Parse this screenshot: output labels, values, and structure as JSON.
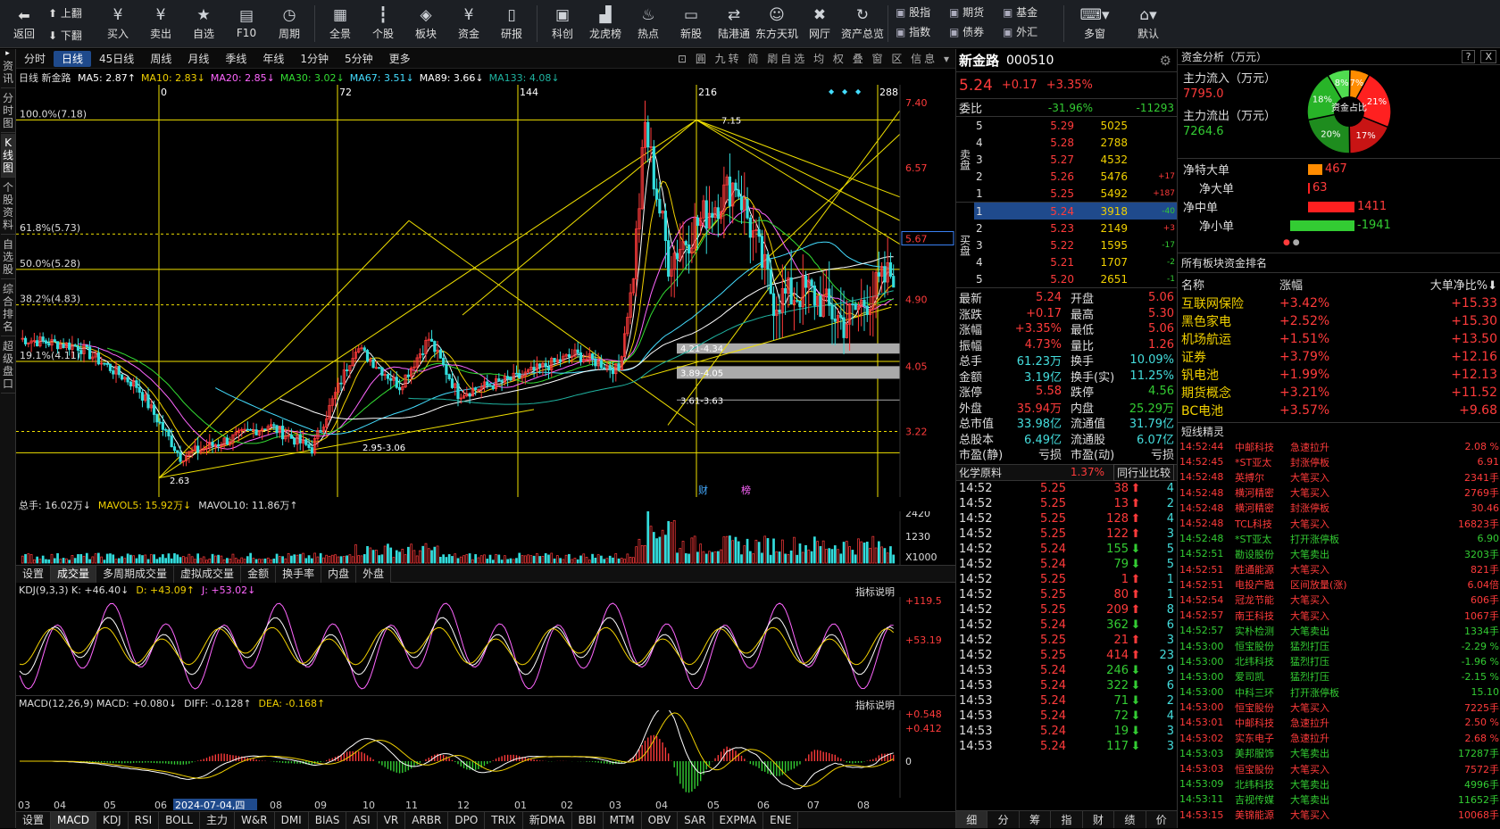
{
  "toolbar": {
    "nav": {
      "back": "返回",
      "up": "上翻",
      "down": "下翻"
    },
    "buttons": [
      {
        "label": "买入",
        "icon": "buy-icon",
        "glyph": "¥"
      },
      {
        "label": "卖出",
        "icon": "sell-icon",
        "glyph": "¥"
      },
      {
        "label": "自选",
        "icon": "star-icon",
        "glyph": "★"
      },
      {
        "label": "F10",
        "icon": "f10-icon",
        "glyph": "▤"
      },
      {
        "label": "周期",
        "icon": "clock-icon",
        "glyph": "◷"
      },
      {
        "label": "全景",
        "icon": "grid-icon",
        "glyph": "▦"
      },
      {
        "label": "个股",
        "icon": "candle-icon",
        "glyph": "┇"
      },
      {
        "label": "板块",
        "icon": "layers-icon",
        "glyph": "◈"
      },
      {
        "label": "资金",
        "icon": "money-icon",
        "glyph": "¥"
      },
      {
        "label": "研报",
        "icon": "report-icon",
        "glyph": "▯"
      },
      {
        "label": "科创",
        "icon": "tech-icon",
        "glyph": "▣"
      },
      {
        "label": "龙虎榜",
        "icon": "barchart-icon",
        "glyph": "▟"
      },
      {
        "label": "热点",
        "icon": "flame-icon",
        "glyph": "♨"
      },
      {
        "label": "新股",
        "icon": "ipo-icon",
        "glyph": "▭"
      },
      {
        "label": "陆港通",
        "icon": "link-icon",
        "glyph": "⇄"
      },
      {
        "label": "东方天玑",
        "icon": "robot-icon",
        "glyph": "☺"
      },
      {
        "label": "网厅",
        "icon": "close-x-icon",
        "glyph": "✖"
      },
      {
        "label": "资产总览",
        "icon": "refresh-icon",
        "glyph": "↻"
      }
    ],
    "small": [
      "股指",
      "期货",
      "基金",
      "指数",
      "债券",
      "外汇"
    ],
    "right": [
      {
        "label": "多窗",
        "icon": "multiwindow-icon",
        "glyph": "⌨"
      },
      {
        "label": "默认",
        "icon": "home-icon",
        "glyph": "⌂"
      }
    ]
  },
  "vtabs": [
    "资讯",
    "分时图",
    "K线图",
    "个股资料",
    "自选股",
    "综合排名",
    "超级盘口"
  ],
  "periods": [
    "分时",
    "日线",
    "45日线",
    "周线",
    "月线",
    "季线",
    "年线",
    "1分钟",
    "5分钟",
    "更多"
  ],
  "period_active": "日线",
  "period_right": "⊡ 圓 九转 简 㓾自选 均 权 叠 窗 区 信息 ▾",
  "ma_legend": {
    "label": "日线 新金路",
    "items": [
      {
        "t": "MA5: 2.87↑",
        "c": "#ffffff"
      },
      {
        "t": "MA10: 2.83↓",
        "c": "#f0d000"
      },
      {
        "t": "MA20: 2.85↓",
        "c": "#ff66ff"
      },
      {
        "t": "MA30: 3.02↓",
        "c": "#33dd33"
      },
      {
        "t": "MA67: 3.51↓",
        "c": "#44ddff"
      },
      {
        "t": "MA89: 3.66↓",
        "c": "#ffffff"
      },
      {
        "t": "MA133: 4.08↓",
        "c": "#1fb3a0"
      }
    ]
  },
  "kline": {
    "price_ticks": [
      "7.40",
      "6.57",
      "5.67",
      "4.90",
      "4.05",
      "3.22"
    ],
    "current_price_tag": "5.67",
    "fib": [
      {
        "t": "100.0%(7.18)"
      },
      {
        "t": "61.8%(5.73)"
      },
      {
        "t": "50.0%(5.28)"
      },
      {
        "t": "38.2%(4.83)"
      },
      {
        "t": "19.1%(4.11)"
      }
    ],
    "cycle_labels": [
      "0",
      "72",
      "144",
      "216",
      "288"
    ],
    "annotations": [
      "7.15",
      "2.63",
      "4.21-4.34",
      "3.89-4.05",
      "3.61-3.63",
      "2.95-3.06"
    ],
    "markers": [
      "财",
      "榜"
    ]
  },
  "volume": {
    "legend": [
      {
        "t": "总手: 16.02万↓",
        "c": "#ddd"
      },
      {
        "t": "MAVOL5: 15.92万↓",
        "c": "#f0d000"
      },
      {
        "t": "MAVOL10: 11.86万↑",
        "c": "#ddd"
      }
    ],
    "ticks": [
      "2420",
      "1230",
      "X1000"
    ]
  },
  "vol_tabs": [
    "设置",
    "成交量",
    "多周期成交量",
    "虚拟成交量",
    "金额",
    "换手率",
    "内盘",
    "外盘"
  ],
  "kdj": {
    "legend": [
      {
        "t": "KDJ(9,3,3) K: +46.40↓",
        "c": "#ddd"
      },
      {
        "t": "D: +43.09↑",
        "c": "#f0d000"
      },
      {
        "t": "J: +53.02↓",
        "c": "#ff66ff"
      }
    ],
    "ticks": [
      "+119.5",
      "+53.19"
    ],
    "explain": "指标说明"
  },
  "macd": {
    "legend": [
      {
        "t": "MACD(12,26,9) MACD: +0.080↓",
        "c": "#ddd"
      },
      {
        "t": "DIFF: -0.128↑",
        "c": "#ddd"
      },
      {
        "t": "DEA: -0.168↑",
        "c": "#f0d000"
      }
    ],
    "ticks": [
      "+0.548",
      "+0.412",
      "0"
    ],
    "explain": "指标说明"
  },
  "date_axis": [
    "03",
    "04",
    "05",
    "06",
    "2024-07-04,四",
    "08",
    "09",
    "10",
    "11",
    "12",
    "01",
    "02",
    "03",
    "04",
    "05",
    "06",
    "07",
    "08"
  ],
  "indicator_tabs": [
    "设置",
    "MACD",
    "KDJ",
    "RSI",
    "BOLL",
    "主力",
    "W&R",
    "DMI",
    "BIAS",
    "ASI",
    "VR",
    "ARBR",
    "DPO",
    "TRIX",
    "新DMA",
    "BBI",
    "MTM",
    "OBV",
    "SAR",
    "EXPMA",
    "ENE"
  ],
  "stock": {
    "name": "新金路",
    "code": "000510",
    "price": "5.24",
    "change": "+0.17",
    "pct": "+3.35%",
    "weibi_label": "委比",
    "weibi": "-31.96%",
    "weicha": "-11293",
    "sell_label": "卖盘",
    "buy_label": "买盘",
    "asks": [
      {
        "n": "5",
        "p": "5.29",
        "v": "5025",
        "d": ""
      },
      {
        "n": "4",
        "p": "5.28",
        "v": "2788",
        "d": ""
      },
      {
        "n": "3",
        "p": "5.27",
        "v": "4532",
        "d": ""
      },
      {
        "n": "2",
        "p": "5.26",
        "v": "5476",
        "d": "+17"
      },
      {
        "n": "1",
        "p": "5.25",
        "v": "5492",
        "d": "+187"
      }
    ],
    "bids": [
      {
        "n": "1",
        "p": "5.24",
        "v": "3918",
        "d": "-40"
      },
      {
        "n": "2",
        "p": "5.23",
        "v": "2149",
        "d": "+3"
      },
      {
        "n": "3",
        "p": "5.22",
        "v": "1595",
        "d": "-17"
      },
      {
        "n": "4",
        "p": "5.21",
        "v": "1707",
        "d": "-2"
      },
      {
        "n": "5",
        "p": "5.20",
        "v": "2651",
        "d": "-1"
      }
    ],
    "stats": [
      [
        "最新",
        "5.24",
        "red",
        "开盘",
        "5.06",
        "red"
      ],
      [
        "涨跌",
        "+0.17",
        "red",
        "最高",
        "5.30",
        "red"
      ],
      [
        "涨幅",
        "+3.35%",
        "red",
        "最低",
        "5.06",
        "red"
      ],
      [
        "振幅",
        "4.73%",
        "red",
        "量比",
        "1.26",
        "red"
      ],
      [
        "总手",
        "61.23万",
        "cyn",
        "换手",
        "10.09%",
        "cyn"
      ],
      [
        "金额",
        "3.19亿",
        "cyn",
        "换手(实)",
        "11.25%",
        "cyn"
      ],
      [
        "涨停",
        "5.58",
        "red",
        "跌停",
        "4.56",
        "grn"
      ],
      [
        "外盘",
        "35.94万",
        "red",
        "内盘",
        "25.29万",
        "grn"
      ],
      [
        "总市值",
        "33.98亿",
        "cyn",
        "流通值",
        "31.79亿",
        "cyn"
      ],
      [
        "总股本",
        "6.49亿",
        "cyn",
        "流通股",
        "6.07亿",
        "cyn"
      ],
      [
        "市盈(静)",
        "亏损",
        "wht",
        "市盈(动)",
        "亏损",
        "wht"
      ]
    ],
    "sector": {
      "name": "化学原料",
      "pct": "1.37%",
      "compare": "同行业比较"
    },
    "ticks": [
      [
        "14:52",
        "5.25",
        "38",
        "up",
        "4"
      ],
      [
        "14:52",
        "5.25",
        "13",
        "up",
        "2"
      ],
      [
        "14:52",
        "5.25",
        "128",
        "up",
        "4"
      ],
      [
        "14:52",
        "5.25",
        "122",
        "up",
        "3"
      ],
      [
        "14:52",
        "5.24",
        "155",
        "dn",
        "5"
      ],
      [
        "14:52",
        "5.24",
        "79",
        "dn",
        "5"
      ],
      [
        "14:52",
        "5.25",
        "1",
        "up",
        "1"
      ],
      [
        "14:52",
        "5.25",
        "80",
        "up",
        "1"
      ],
      [
        "14:52",
        "5.25",
        "209",
        "up",
        "8"
      ],
      [
        "14:52",
        "5.24",
        "362",
        "dn",
        "6"
      ],
      [
        "14:52",
        "5.25",
        "21",
        "up",
        "3"
      ],
      [
        "14:52",
        "5.25",
        "414",
        "up",
        "23"
      ],
      [
        "14:53",
        "5.24",
        "246",
        "dn",
        "9"
      ],
      [
        "14:53",
        "5.24",
        "322",
        "dn",
        "6"
      ],
      [
        "14:53",
        "5.24",
        "71",
        "dn",
        "2"
      ],
      [
        "14:53",
        "5.24",
        "72",
        "dn",
        "4"
      ],
      [
        "14:53",
        "5.24",
        "19",
        "dn",
        "3"
      ],
      [
        "14:53",
        "5.24",
        "117",
        "dn",
        "3"
      ]
    ],
    "bottom_tabs": [
      "细",
      "分",
      "筹",
      "指",
      "财",
      "绩",
      "价"
    ]
  },
  "fund": {
    "title": "资金分析（万元）",
    "help": "?",
    "close": "X",
    "inflow_label": "主力流入（万元）",
    "inflow": "7795.0",
    "outflow_label": "主力流出（万元）",
    "outflow": "7264.6",
    "pie_center": "资金占比",
    "pie": [
      {
        "v": 7,
        "c": "#ff8c00",
        "t": "7%"
      },
      {
        "v": 21,
        "c": "#ff2020",
        "t": "21%"
      },
      {
        "v": 17,
        "c": "#c81414",
        "t": "17%"
      },
      {
        "v": 20,
        "c": "#1e8c1e",
        "t": "20%"
      },
      {
        "v": 18,
        "c": "#28b428",
        "t": "18%"
      },
      {
        "v": 8,
        "c": "#50dc50",
        "t": "8%"
      }
    ],
    "net": [
      {
        "l": "净特大单",
        "v": "467",
        "w": 8,
        "c": "#ff8c00",
        "s": "red"
      },
      {
        "l": "净大单",
        "v": "63",
        "w": 1,
        "c": "#ff2020",
        "s": "red"
      },
      {
        "l": "净中单",
        "v": "1411",
        "w": 26,
        "c": "#ff2020",
        "s": "red"
      },
      {
        "l": "净小单",
        "v": "-1941",
        "w": 36,
        "c": "#33cc33",
        "s": "grn"
      }
    ],
    "sector_title": "所有板块资金排名",
    "sector_head": [
      "名称",
      "涨幅",
      "大单净比%"
    ],
    "sectors": [
      [
        "互联网保险",
        "+3.42%",
        "+15.33"
      ],
      [
        "黑色家电",
        "+2.52%",
        "+15.30"
      ],
      [
        "机场航运",
        "+1.51%",
        "+13.50"
      ],
      [
        "证券",
        "+3.79%",
        "+12.16"
      ],
      [
        "钒电池",
        "+1.99%",
        "+12.13"
      ],
      [
        "期货概念",
        "+3.21%",
        "+11.52"
      ],
      [
        "BC电池",
        "+3.57%",
        "+9.68"
      ]
    ],
    "spirit_title": "短线精灵",
    "spirit": [
      [
        "14:52:44",
        "中邮科技",
        "急速拉升",
        "2.08 %",
        "r"
      ],
      [
        "14:52:45",
        "*ST亚太",
        "封涨停板",
        "6.91",
        "r"
      ],
      [
        "14:52:48",
        "英搏尔",
        "大笔买入",
        "2341手",
        "r"
      ],
      [
        "14:52:48",
        "横河精密",
        "大笔买入",
        "2769手",
        "r"
      ],
      [
        "14:52:48",
        "横河精密",
        "封涨停板",
        "30.46",
        "r"
      ],
      [
        "14:52:48",
        "TCL科技",
        "大笔买入",
        "16823手",
        "r"
      ],
      [
        "14:52:48",
        "*ST亚太",
        "打开涨停板",
        "6.90",
        "g"
      ],
      [
        "14:52:51",
        "勘设股份",
        "大笔卖出",
        "3203手",
        "g"
      ],
      [
        "14:52:51",
        "胜通能源",
        "大笔买入",
        "821手",
        "r"
      ],
      [
        "14:52:51",
        "电投产融",
        "区间放量(涨)",
        "6.04倍",
        "r"
      ],
      [
        "14:52:54",
        "冠龙节能",
        "大笔买入",
        "606手",
        "r"
      ],
      [
        "14:52:57",
        "南王科技",
        "大笔买入",
        "1067手",
        "r"
      ],
      [
        "14:52:57",
        "实朴检测",
        "大笔卖出",
        "1334手",
        "g"
      ],
      [
        "14:53:00",
        "恒宝股份",
        "猛烈打压",
        "-2.29 %",
        "g"
      ],
      [
        "14:53:00",
        "北纬科技",
        "猛烈打压",
        "-1.96 %",
        "g"
      ],
      [
        "14:53:00",
        "爱司凯",
        "猛烈打压",
        "-2.15 %",
        "g"
      ],
      [
        "14:53:00",
        "中科三环",
        "打开涨停板",
        "15.10",
        "g"
      ],
      [
        "14:53:00",
        "恒宝股份",
        "大笔买入",
        "7225手",
        "r"
      ],
      [
        "14:53:01",
        "中邮科技",
        "急速拉升",
        "2.50 %",
        "r"
      ],
      [
        "14:53:02",
        "实东电子",
        "急速拉升",
        "2.68 %",
        "r"
      ],
      [
        "14:53:03",
        "美邦服饰",
        "大笔卖出",
        "17287手",
        "g"
      ],
      [
        "14:53:03",
        "恒宝股份",
        "大笔买入",
        "7572手",
        "r"
      ],
      [
        "14:53:09",
        "北纬科技",
        "大笔卖出",
        "4996手",
        "g"
      ],
      [
        "14:53:11",
        "吉视传媒",
        "大笔卖出",
        "11652手",
        "g"
      ],
      [
        "14:53:15",
        "美锦能源",
        "大笔买入",
        "10068手",
        "r"
      ]
    ]
  }
}
